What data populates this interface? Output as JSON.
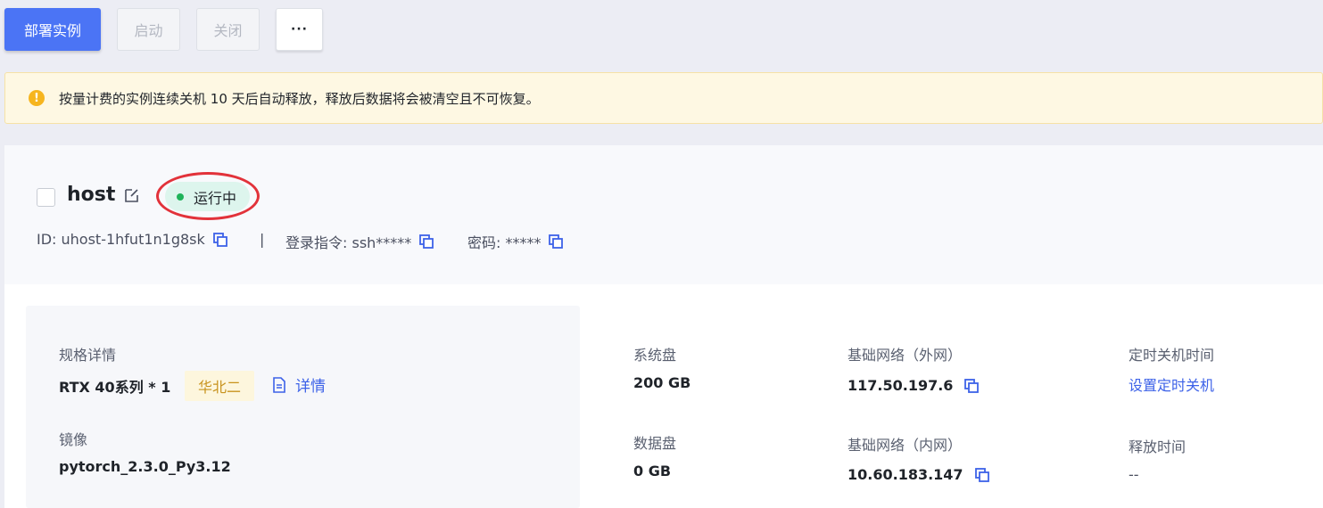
{
  "toolbar": {
    "deploy_label": "部署实例",
    "start_label": "启动",
    "stop_label": "关闭",
    "more_label": "···"
  },
  "notice": {
    "icon": "!",
    "text": "按量计费的实例连续关机 10 天后自动释放，释放后数据将会被清空且不可恢复。"
  },
  "instance": {
    "name": "host",
    "status": "运行中",
    "id_text": "ID: uhost-1hfut1n1g8sk",
    "separator": "|",
    "login_cmd_text": "登录指令: ssh*****",
    "password_text": "密码: *****"
  },
  "spec": {
    "spec_label": "规格详情",
    "spec_value": "RTX 40系列 * 1",
    "region": "华北二",
    "detail_link": "详情",
    "image_label": "镜像",
    "image_value": "pytorch_2.3.0_Py3.12"
  },
  "disks": {
    "system_label": "系统盘",
    "system_value": "200 GB",
    "data_label": "数据盘",
    "data_value": "0 GB"
  },
  "network": {
    "public_label": "基础网络（外网）",
    "public_ip": "117.50.197.6",
    "private_label": "基础网络（内网）",
    "private_ip": "10.60.183.147"
  },
  "schedule": {
    "shutdown_label": "定时关机时间",
    "shutdown_link": "设置定时关机",
    "release_label": "释放时间",
    "release_value": "--"
  },
  "colors": {
    "primary": "#4b74f5",
    "link": "#3d62e8",
    "status_green": "#1fb35a",
    "highlight_red": "#e2323a",
    "warning": "#f6b51f"
  }
}
